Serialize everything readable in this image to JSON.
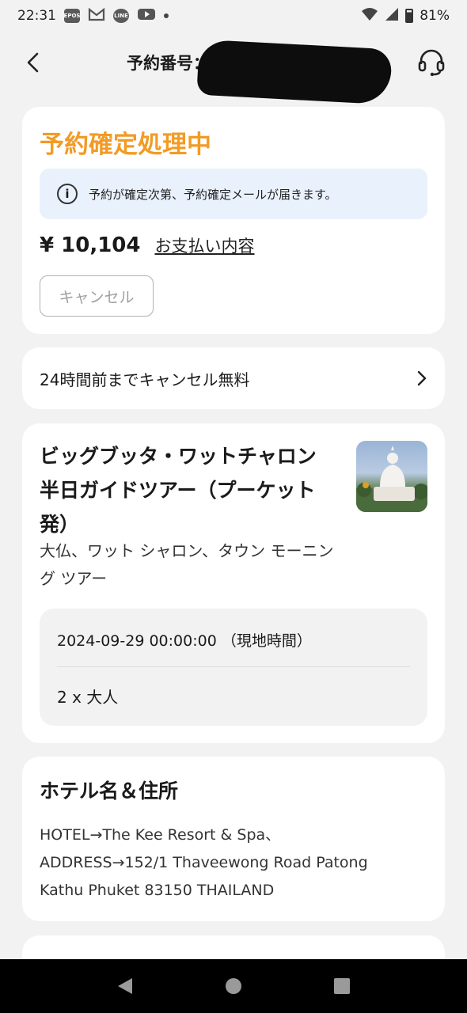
{
  "status_bar": {
    "time": "22:31",
    "battery": "81%",
    "icons": [
      "epos-icon",
      "gmail-icon",
      "line-icon",
      "youtube-icon",
      "notification-dot"
    ],
    "epos_label": "EPOS",
    "line_label": "LINE"
  },
  "header": {
    "title": "予約番号：",
    "back_icon": "chevron-left-icon",
    "support_icon": "headset-icon"
  },
  "booking_status": {
    "title": "予約確定処理中",
    "title_color": "#f29b25",
    "info_message": "予約が確定次第、予約確定メールが届きます。",
    "price": "¥ 10,104",
    "payment_link": "お支払い内容",
    "cancel_label": "キャンセル"
  },
  "cancellation_policy": {
    "text": "24時間前までキャンセル無料"
  },
  "tour": {
    "title": "ビッグブッタ・ワットチャロン 半日ガイドツアー（プーケット発）",
    "subtitle": "大仏、ワット シャロン、タウン モーニング ツアー",
    "date": "2024-09-29 00:00:00 （現地時間）",
    "guests": "2 x 大人"
  },
  "hotel": {
    "heading": "ホテル名＆住所",
    "line1": "HOTEL→The Kee Resort & Spa、",
    "line2": "ADDRESS→152/1 Thaveewong Road Patong",
    "line3": "Kathu Phuket 83150 THAILAND"
  },
  "nav": {
    "back": "back-triangle-icon",
    "home": "home-circle-icon",
    "recents": "recents-square-icon"
  }
}
